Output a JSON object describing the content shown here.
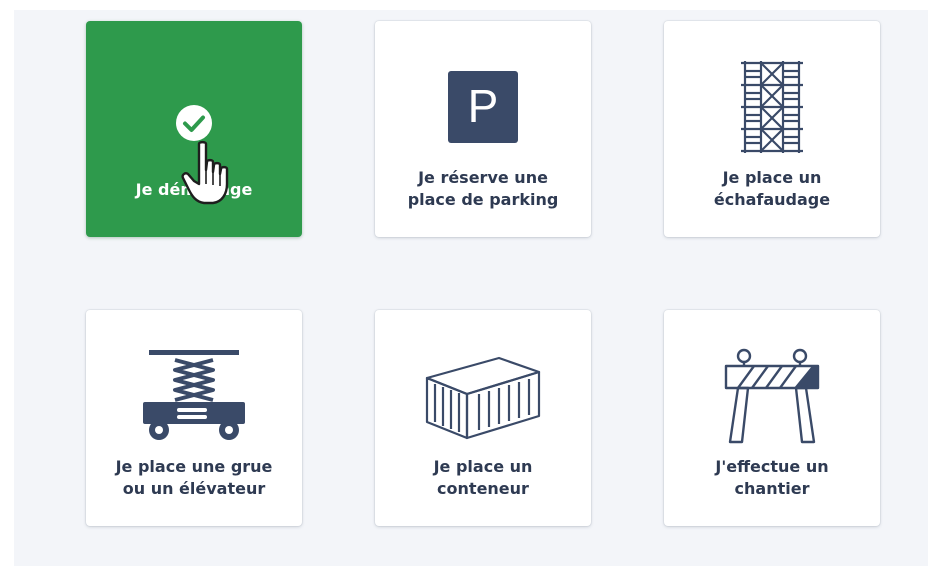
{
  "cards": [
    {
      "label": "Je déménage",
      "selected": true,
      "icon": "check-circle-icon"
    },
    {
      "label": "Je réserve une\nplace de parking",
      "selected": false,
      "icon": "parking-icon",
      "icon_text": "P"
    },
    {
      "label": "Je place un\néchafaudage",
      "selected": false,
      "icon": "scaffolding-icon"
    },
    {
      "label": "Je place une grue\nou un élévateur",
      "selected": false,
      "icon": "scissor-lift-icon"
    },
    {
      "label": "Je place un\nconteneur",
      "selected": false,
      "icon": "container-icon"
    },
    {
      "label": "J'effectue un\nchantier",
      "selected": false,
      "icon": "road-barrier-icon"
    }
  ],
  "colors": {
    "selected": "#2e9a4c",
    "icon": "#3a4a68",
    "text": "#2e3a52",
    "panel": "#f3f5f9"
  },
  "cursor": "hand-pointer-icon"
}
